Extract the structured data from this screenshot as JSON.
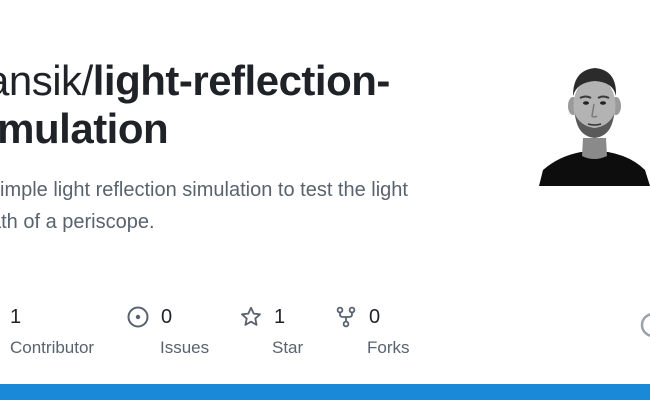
{
  "repo": {
    "owner": "ansik",
    "separator": "/",
    "name_line1": "light-reflection-",
    "name_line2": "imulation",
    "description_line1": "simple light reflection simulation to test the light",
    "description_line2": "ath of a periscope."
  },
  "stats": [
    {
      "value": "1",
      "label": "Contributor",
      "icon": "people-icon"
    },
    {
      "value": "0",
      "label": "Issues",
      "icon": "issue-opened-icon"
    },
    {
      "value": "1",
      "label": "Star",
      "icon": "star-icon"
    },
    {
      "value": "0",
      "label": "Forks",
      "icon": "repo-forked-icon"
    }
  ],
  "colors": {
    "title": "#1f2328",
    "muted": "#59636e",
    "bottom_bar": "#1a8ad8",
    "background": "#ffffff"
  }
}
